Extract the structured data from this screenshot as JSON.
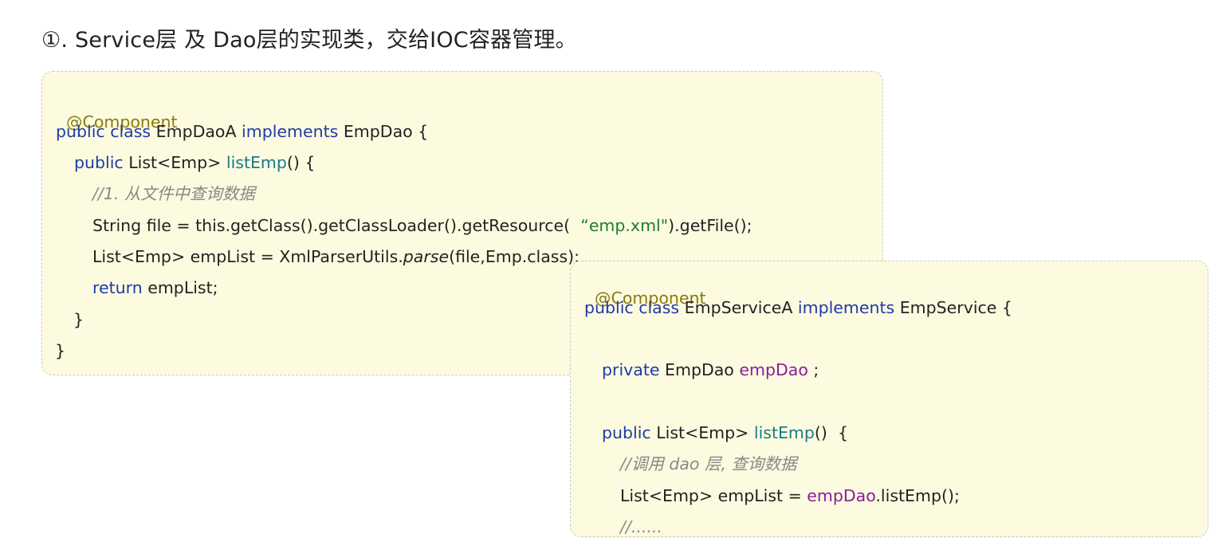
{
  "heading": "①. Service层 及 Dao层的实现类，交给IOC容器管理。",
  "dao_code": {
    "l1_annotation": "@Component",
    "l2_public": "public",
    "l2_class": "class",
    "l2_name": "EmpDaoA",
    "l2_implements": "implements",
    "l2_iface": "EmpDao {",
    "l3_public": "public",
    "l3_type": "List<Emp>",
    "l3_method": "listEmp",
    "l3_rest": "() {",
    "l4_comment": "//1. 从文件中查询数据",
    "l5_pre": "String file = this.getClass().getClassLoader().getResource(",
    "l5_str": "“emp.xml\"",
    "l5_post": ").getFile();",
    "l6_pre": "List<Emp> empList = XmlParserUtils.",
    "l6_parse": "parse",
    "l6_post": "(file,Emp.class);",
    "l7_return": "return",
    "l7_rest": "empList;",
    "l8_brace": "}",
    "l9_brace": "}"
  },
  "service_code": {
    "l1_annotation": "@Component",
    "l2_public": "public",
    "l2_class": "class",
    "l2_name": "EmpServiceA",
    "l2_implements": "implements",
    "l2_iface": "EmpService {",
    "l3_private": "private",
    "l3_type": "EmpDao",
    "l3_field": "empDao",
    "l3_end": ";",
    "l4_public": "public",
    "l4_type": "List<Emp>",
    "l4_method": "listEmp",
    "l4_rest": "()  {",
    "l5_comment": "//调用 dao 层, 查询数据",
    "l6_pre": "List<Emp> empList = ",
    "l6_field": "empDao",
    "l6_post": ".listEmp();",
    "l7_comment": "//......"
  }
}
